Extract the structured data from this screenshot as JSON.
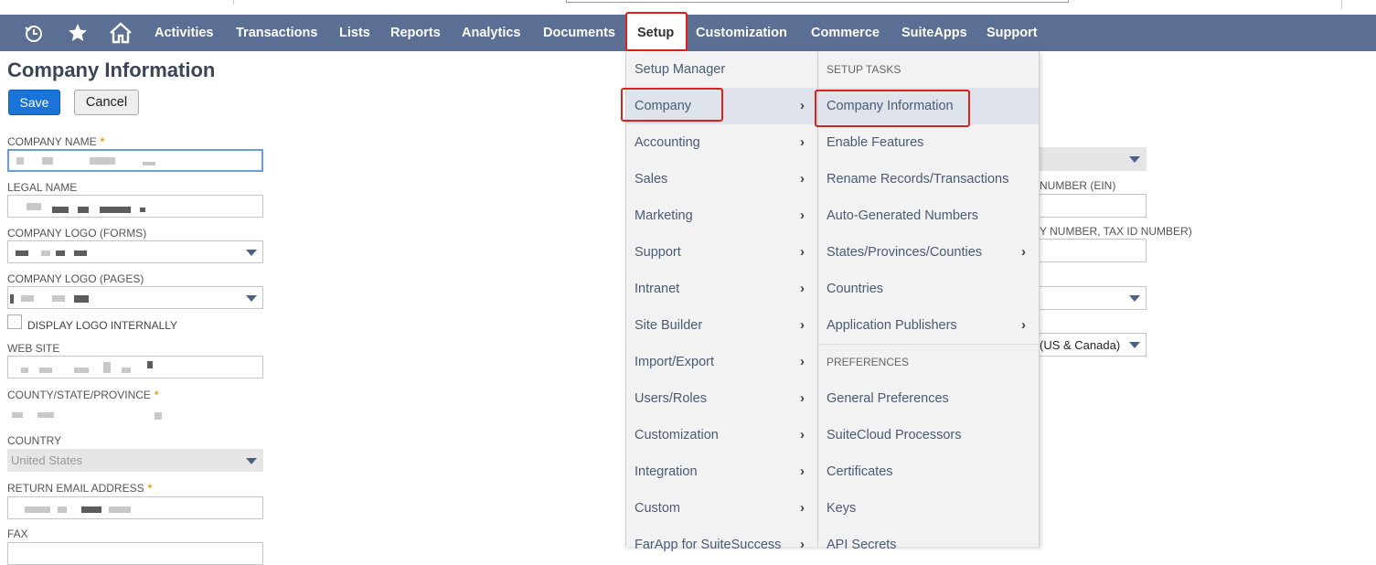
{
  "navbar": {
    "icons": [
      "recent-icon",
      "star-icon",
      "home-icon"
    ],
    "items": [
      "Activities",
      "Transactions",
      "Lists",
      "Reports",
      "Analytics",
      "Documents",
      "Setup",
      "Customization",
      "Commerce",
      "SuiteApps",
      "Support"
    ],
    "active": "Setup"
  },
  "page": {
    "title": "Company Information",
    "save_label": "Save",
    "cancel_label": "Cancel"
  },
  "form": {
    "company_name_label": "COMPANY NAME",
    "legal_name_label": "LEGAL NAME",
    "logo_forms_label": "COMPANY LOGO (FORMS)",
    "logo_pages_label": "COMPANY LOGO (PAGES)",
    "display_logo_label": "DISPLAY LOGO INTERNALLY",
    "website_label": "WEB SITE",
    "county_label": "COUNTY/STATE/PROVINCE",
    "country_label": "COUNTRY",
    "country_value": "United States",
    "return_email_label": "RETURN EMAIL ADDRESS",
    "fax_label": "FAX",
    "required_mark": "*"
  },
  "right_partial": {
    "ein_label": "NUMBER (EIN)",
    "taxid_label": "Y NUMBER, TAX ID NUMBER)",
    "timezone_value": "(US & Canada)"
  },
  "setup_menu": {
    "items": [
      {
        "label": "Setup Manager",
        "submenu": false
      },
      {
        "label": "Company",
        "submenu": true,
        "selected": true
      },
      {
        "label": "Accounting",
        "submenu": true
      },
      {
        "label": "Sales",
        "submenu": true
      },
      {
        "label": "Marketing",
        "submenu": true
      },
      {
        "label": "Support",
        "submenu": true
      },
      {
        "label": "Intranet",
        "submenu": true
      },
      {
        "label": "Site Builder",
        "submenu": true
      },
      {
        "label": "Import/Export",
        "submenu": true
      },
      {
        "label": "Users/Roles",
        "submenu": true
      },
      {
        "label": "Customization",
        "submenu": true
      },
      {
        "label": "Integration",
        "submenu": true
      },
      {
        "label": "Custom",
        "submenu": true
      },
      {
        "label": "FarApp for SuiteSuccess",
        "submenu": true
      }
    ]
  },
  "company_submenu": {
    "setup_tasks_header": "SETUP TASKS",
    "setup_tasks": [
      {
        "label": "Company Information",
        "submenu": false,
        "selected": true
      },
      {
        "label": "Enable Features",
        "submenu": false
      },
      {
        "label": "Rename Records/Transactions",
        "submenu": false
      },
      {
        "label": "Auto-Generated Numbers",
        "submenu": false
      },
      {
        "label": "States/Provinces/Counties",
        "submenu": true
      },
      {
        "label": "Countries",
        "submenu": false
      },
      {
        "label": "Application Publishers",
        "submenu": true
      }
    ],
    "preferences_header": "PREFERENCES",
    "preferences": [
      {
        "label": "General Preferences"
      },
      {
        "label": "SuiteCloud Processors"
      },
      {
        "label": "Certificates"
      },
      {
        "label": "Keys"
      },
      {
        "label": "API Secrets"
      }
    ]
  },
  "colors": {
    "navbar": "#5b6e93",
    "save_button": "#1a74d8",
    "highlight_border": "#e0201a",
    "menu_bg": "#f2f2f2",
    "required": "#e3a014"
  }
}
